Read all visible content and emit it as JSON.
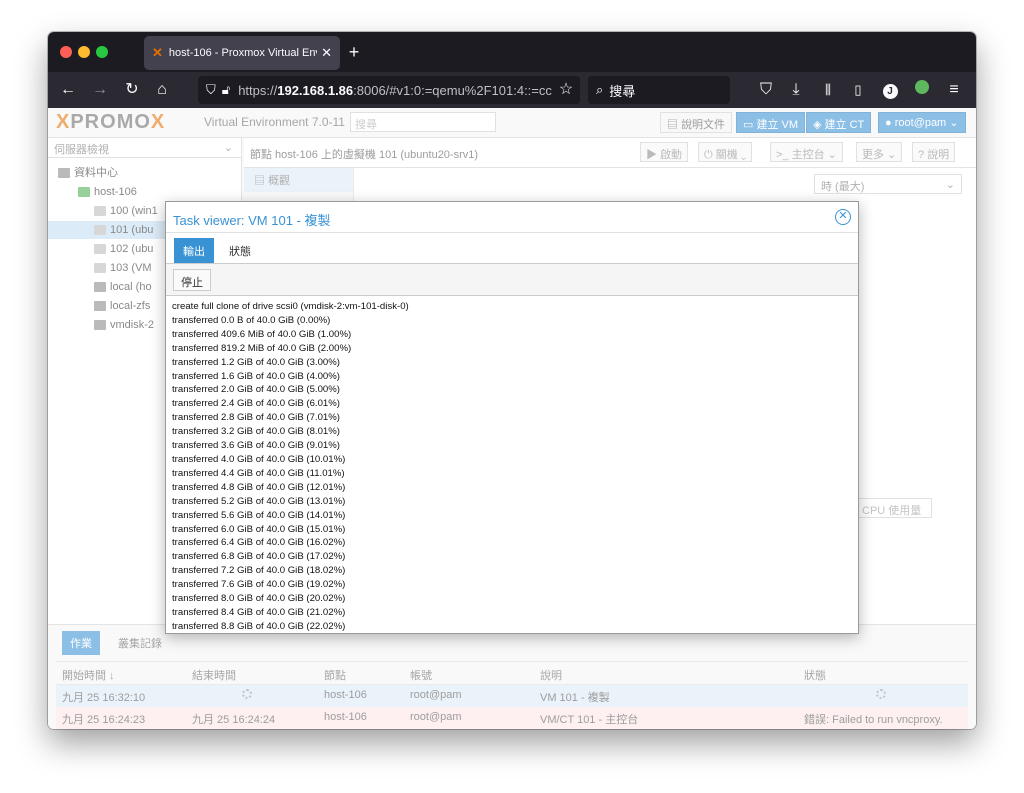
{
  "browser": {
    "tab_title": "host-106 - Proxmox Virtual Envi",
    "url_prefix": "https://",
    "url_host": "192.168.1.86",
    "url_rest": ":8006/#v1:0:=qemu%2F101:4::=cc",
    "search_placeholder": "搜尋"
  },
  "pve": {
    "logo_pro": "PRO",
    "logo_x1": "X",
    "logo_mo": "MO",
    "logo_x2": "X",
    "env": "Virtual Environment 7.0-11",
    "search_placeholder": "搜尋",
    "docs_label": "說明文件",
    "create_vm_label": "建立 VM",
    "create_ct_label": "建立 CT",
    "user_label": "root@pam"
  },
  "tree": {
    "view_label": "伺服器檢視",
    "items": [
      {
        "label": "資料中心"
      },
      {
        "label": "host-106"
      },
      {
        "label": "100 (win1"
      },
      {
        "label": "101 (ubu"
      },
      {
        "label": "102 (ubu"
      },
      {
        "label": "103 (VM"
      },
      {
        "label": "local (ho"
      },
      {
        "label": "local-zfs"
      },
      {
        "label": "vmdisk-2"
      }
    ]
  },
  "content": {
    "title": "節點 host-106 上的虛擬機 101 (ubuntu20-srv1)",
    "start_label": "啟動",
    "shutdown_label": "關機",
    "console_label": "主控台",
    "more_label": "更多",
    "help_label": "說明",
    "summary_label": "概觀",
    "timeframe_label": "時 (最大)",
    "cpu_usage_label": "CPU 使用量"
  },
  "bottom": {
    "tabs": [
      "作業",
      "叢集記錄"
    ],
    "headers": [
      "開始時間 ↓",
      "結束時間",
      "節點",
      "帳號",
      "說明",
      "狀態"
    ],
    "rows": [
      {
        "start": "九月 25 16:32:10",
        "end": "",
        "node": "host-106",
        "user": "root@pam",
        "desc": "VM 101 - 複製",
        "status": ""
      },
      {
        "start": "九月 25 16:24:23",
        "end": "九月 25 16:24:24",
        "node": "host-106",
        "user": "root@pam",
        "desc": "VM/CT 101 - 主控台",
        "status": "錯誤: Failed to run vncproxy."
      }
    ]
  },
  "dialog": {
    "title": "Task viewer: VM 101 - 複製",
    "tab_output": "輸出",
    "tab_status": "狀態",
    "stop_label": "停止",
    "log": [
      "create full clone of drive scsi0 (vmdisk-2:vm-101-disk-0)",
      "transferred 0.0 B of 40.0 GiB (0.00%)",
      "transferred 409.6 MiB of 40.0 GiB (1.00%)",
      "transferred 819.2 MiB of 40.0 GiB (2.00%)",
      "transferred 1.2 GiB of 40.0 GiB (3.00%)",
      "transferred 1.6 GiB of 40.0 GiB (4.00%)",
      "transferred 2.0 GiB of 40.0 GiB (5.00%)",
      "transferred 2.4 GiB of 40.0 GiB (6.01%)",
      "transferred 2.8 GiB of 40.0 GiB (7.01%)",
      "transferred 3.2 GiB of 40.0 GiB (8.01%)",
      "transferred 3.6 GiB of 40.0 GiB (9.01%)",
      "transferred 4.0 GiB of 40.0 GiB (10.01%)",
      "transferred 4.4 GiB of 40.0 GiB (11.01%)",
      "transferred 4.8 GiB of 40.0 GiB (12.01%)",
      "transferred 5.2 GiB of 40.0 GiB (13.01%)",
      "transferred 5.6 GiB of 40.0 GiB (14.01%)",
      "transferred 6.0 GiB of 40.0 GiB (15.01%)",
      "transferred 6.4 GiB of 40.0 GiB (16.02%)",
      "transferred 6.8 GiB of 40.0 GiB (17.02%)",
      "transferred 7.2 GiB of 40.0 GiB (18.02%)",
      "transferred 7.6 GiB of 40.0 GiB (19.02%)",
      "transferred 8.0 GiB of 40.0 GiB (20.02%)",
      "transferred 8.4 GiB of 40.0 GiB (21.02%)",
      "transferred 8.8 GiB of 40.0 GiB (22.02%)"
    ]
  },
  "colors": {
    "accent": "#3892d4",
    "logo_orange": "#e57000",
    "error_row": "#fde6e6",
    "selected_row": "#dcebf7"
  }
}
